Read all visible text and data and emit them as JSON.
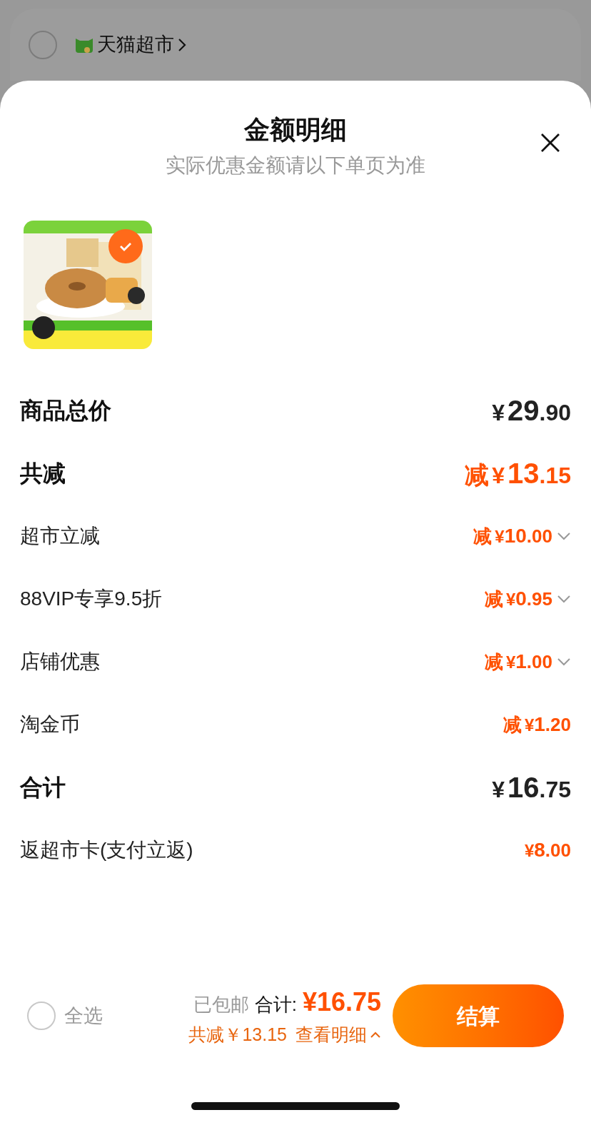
{
  "store": {
    "name": "天猫超市",
    "selected": false
  },
  "sheet": {
    "title": "金额明细",
    "subtitle": "实际优惠金额请以下单页为准",
    "product": {
      "kind": "picture",
      "checked": true
    }
  },
  "rows": [
    {
      "kind": "main",
      "label": "商品总价",
      "prefix": "",
      "currency": "¥",
      "yuan": "29",
      "cents": ".90",
      "expandable": false
    },
    {
      "kind": "main_discount",
      "label": "共减",
      "prefix": "减",
      "currency": "¥",
      "yuan": "13",
      "cents": ".15",
      "expandable": false
    },
    {
      "kind": "discount",
      "label": "超市立减",
      "prefix": "减",
      "currency": "¥",
      "yuan": "10",
      "cents": ".00",
      "expandable": true
    },
    {
      "kind": "discount",
      "label": "88VIP专享9.5折",
      "prefix": "减",
      "currency": "¥",
      "yuan": "0",
      "cents": ".95",
      "expandable": true
    },
    {
      "kind": "discount",
      "label": "店铺优惠",
      "prefix": "减",
      "currency": "¥",
      "yuan": "1",
      "cents": ".00",
      "expandable": true
    },
    {
      "kind": "discount",
      "label": "淘金币",
      "prefix": "减",
      "currency": "¥",
      "yuan": "1",
      "cents": ".20",
      "expandable": false
    },
    {
      "kind": "main",
      "label": "合计",
      "prefix": "",
      "currency": "¥",
      "yuan": "16",
      "cents": ".75",
      "expandable": false
    },
    {
      "kind": "discount",
      "label": "返超市卡(支付立返)",
      "prefix": "",
      "currency": "¥",
      "yuan": "8",
      "cents": ".00",
      "expandable": false
    }
  ],
  "footer": {
    "select_all": {
      "label": "全选",
      "checked": false
    },
    "shipping": "已包邮",
    "total_label": "合计:",
    "total": "¥16.75",
    "discount": "共减￥13.15",
    "details_link": "查看明细",
    "details_expanded": true,
    "checkout": "结算"
  }
}
